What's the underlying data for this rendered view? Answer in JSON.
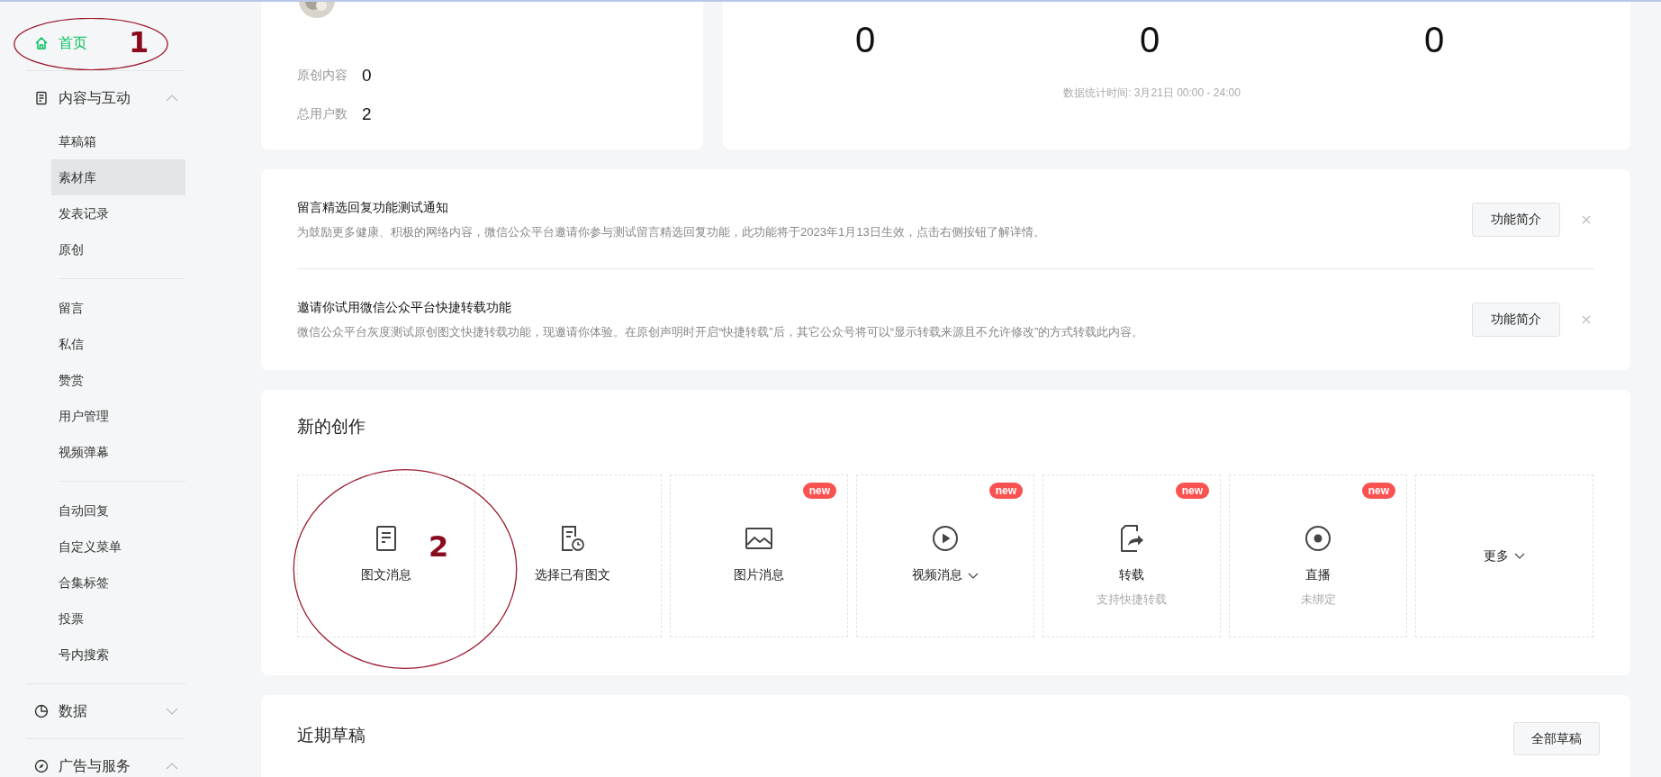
{
  "sidebar": {
    "items": [
      {
        "label": "首页",
        "selected": true
      },
      {
        "label": "内容与互动",
        "selected": false,
        "expanded": true,
        "sections": [
          {
            "items": [
              {
                "label": "草稿箱",
                "highlighted": false
              },
              {
                "label": "素材库",
                "highlighted": true
              },
              {
                "label": "发表记录",
                "highlighted": false
              },
              {
                "label": "原创",
                "highlighted": false
              }
            ]
          },
          {
            "items": [
              {
                "label": "留言",
                "highlighted": false
              },
              {
                "label": "私信",
                "highlighted": false
              },
              {
                "label": "赞赏",
                "highlighted": false
              },
              {
                "label": "用户管理",
                "highlighted": false
              },
              {
                "label": "视频弹幕",
                "highlighted": false
              }
            ]
          },
          {
            "items": [
              {
                "label": "自动回复",
                "highlighted": false
              },
              {
                "label": "自定义菜单",
                "highlighted": false
              },
              {
                "label": "合集标签",
                "highlighted": false
              },
              {
                "label": "投票",
                "highlighted": false
              },
              {
                "label": "号内搜索",
                "highlighted": false
              }
            ]
          }
        ]
      },
      {
        "label": "数据",
        "selected": false,
        "expanded": false
      },
      {
        "label": "广告与服务",
        "selected": false,
        "expanded": true
      }
    ]
  },
  "account": {
    "rows": [
      {
        "label": "原创内容",
        "value": "0"
      },
      {
        "label": "总用户数",
        "value": "2"
      }
    ]
  },
  "stats": {
    "values": [
      "0",
      "0",
      "0"
    ],
    "time_note": "数据统计时间: 3月21日 00:00 - 24:00"
  },
  "notices": [
    {
      "title": "留言精选回复功能测试通知",
      "text": "为鼓励更多健康、积极的网络内容，微信公众平台邀请你参与测试留言精选回复功能，此功能将于2023年1月13日生效，点击右侧按钮了解详情。",
      "button": "功能简介",
      "closable": true
    },
    {
      "title": "邀请你试用微信公众平台快捷转载功能",
      "text": "微信公众平台灰度测试原创图文快捷转载功能，现邀请你体验。在原创声明时开启“快捷转载”后，其它公众号将可以“显示转载来源且不允许修改”的方式转载此内容。",
      "button": "功能简介",
      "closable": true
    }
  ],
  "creation": {
    "title": "新的创作",
    "tiles": [
      {
        "label": "图文消息",
        "has_menu": false
      },
      {
        "label": "选择已有图文",
        "has_menu": false
      },
      {
        "label": "图片消息",
        "badge": "new",
        "has_menu": false
      },
      {
        "label": "视频消息",
        "badge": "new",
        "has_menu": true
      },
      {
        "label": "转载",
        "sublabel": "支持快捷转载",
        "badge": "new",
        "has_menu": false
      },
      {
        "label": "直播",
        "sublabel": "未绑定",
        "badge": "new",
        "has_menu": false
      },
      {
        "label": "更多",
        "has_menu": true
      }
    ]
  },
  "drafts": {
    "title": "近期草稿",
    "button": "全部草稿"
  },
  "annotations": [
    {
      "label": "1"
    },
    {
      "label": "2"
    }
  ]
}
